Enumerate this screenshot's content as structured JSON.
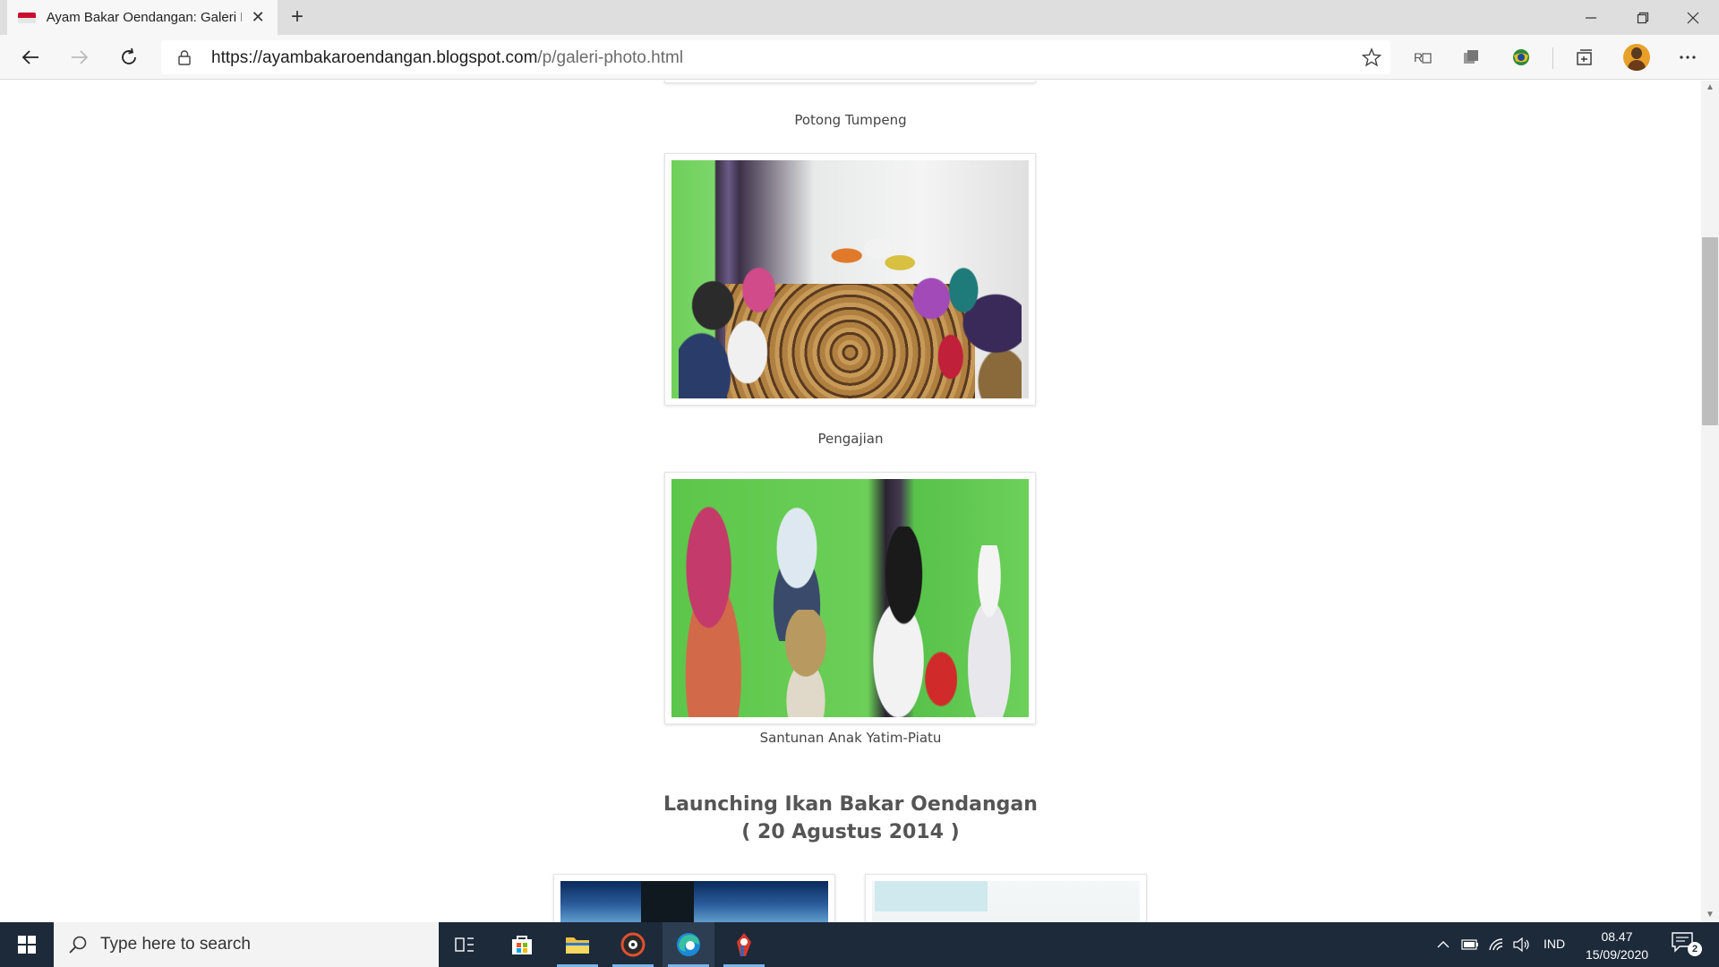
{
  "browser": {
    "tab_title": "Ayam Bakar Oendangan: Galeri P",
    "url_host": "https://ayambakaroendangan.blogspot.com",
    "url_path": "/p/galeri-photo.html"
  },
  "page": {
    "captions": [
      "Potong Tumpeng",
      "Pengajian",
      "Santunan Anak Yatim-Piatu"
    ],
    "section_heading_line1": "Launching Ikan Bakar Oendangan",
    "section_heading_line2": "( 20 Agustus 2014 )"
  },
  "taskbar": {
    "search_placeholder": "Type here to search",
    "language": "IND",
    "time": "08.47",
    "date": "15/09/2020",
    "notification_count": "2"
  },
  "colors": {
    "taskbar_bg": "#1c2a3a",
    "tab_bar_bg": "#dedede",
    "accent_underline": "#7ab4ea"
  }
}
